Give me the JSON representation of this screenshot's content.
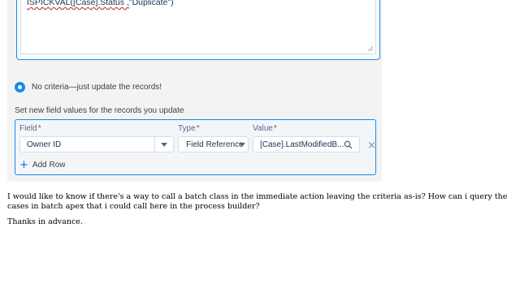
{
  "formula": {
    "text_prefix": "ISPICKVAL([Case].Status ,",
    "text_suffix": "\"Duplicate\")"
  },
  "criteria": {
    "option_label": "No criteria—just update the records!"
  },
  "field_values": {
    "section_label": "Set new field values for the records you update",
    "field_label": "Field",
    "type_label": "Type",
    "value_label": "Value",
    "required_mark": "*",
    "row": {
      "field": "Owner ID",
      "type": "Field Reference",
      "value": "[Case].LastModifiedB..."
    },
    "add_row_label": "Add Row"
  },
  "post": {
    "question": "I would like to know if there's a way to call a batch class in the immediate action leaving the criteria as-is? How can i query the cases in batch apex that i could call here in the process builder?",
    "thanks": "Thanks in advance."
  },
  "colors": {
    "accent": "#1589ee",
    "required": "#c23934",
    "panel_bg": "#f3f3f3"
  }
}
